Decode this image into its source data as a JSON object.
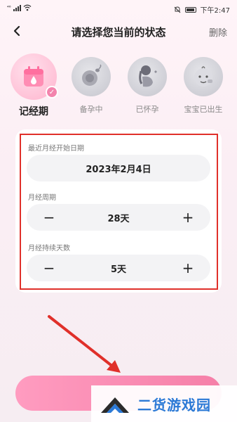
{
  "status_bar": {
    "signal_text": "⁴⁶",
    "time": "下午2:47"
  },
  "nav": {
    "title": "请选择您当前的状态",
    "delete_label": "删除"
  },
  "states": [
    {
      "label": "记经期",
      "selected": true
    },
    {
      "label": "备孕中",
      "selected": false
    },
    {
      "label": "已怀孕",
      "selected": false
    },
    {
      "label": "宝宝已出生",
      "selected": false
    }
  ],
  "form": {
    "last_period_label": "最近月经开始日期",
    "last_period_value": "2023年2月4日",
    "cycle_label": "月经周期",
    "cycle_value": "28天",
    "duration_label": "月经持续天数",
    "duration_value": "5天",
    "minus_symbol": "−",
    "plus_symbol": "+"
  },
  "colors": {
    "accent_pink": "#f57fa8",
    "highlight_red": "#e0302a",
    "watermark_blue": "#2b79d6"
  },
  "watermark": {
    "text": "二货游戏园"
  }
}
